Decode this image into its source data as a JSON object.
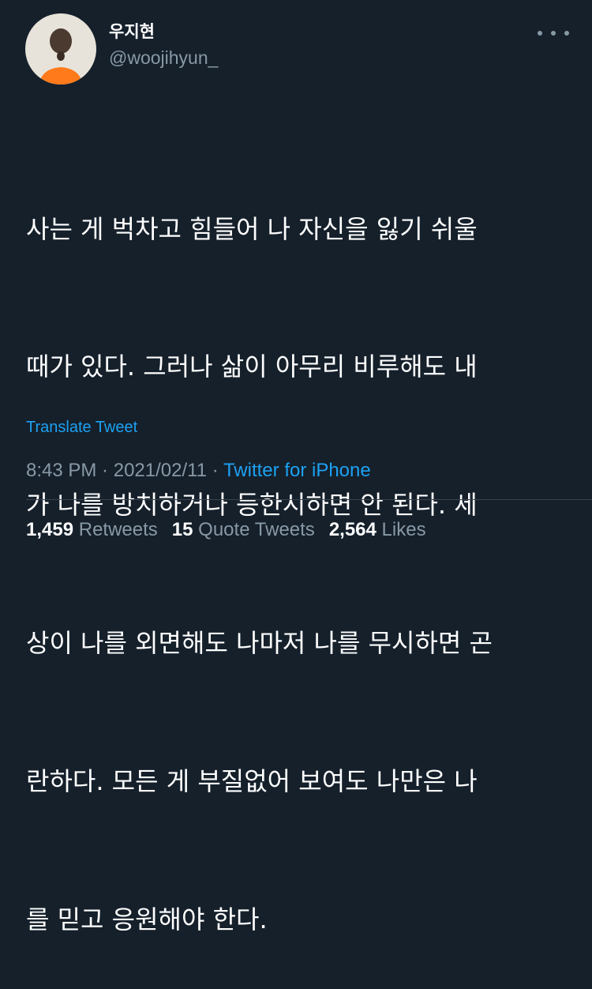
{
  "author": {
    "display_name": "우지현",
    "handle": "@woojihyun_"
  },
  "tweet": {
    "lines": [
      "사는 게 벅차고 힘들어 나 자신을 잃기 쉬울",
      "때가 있다. 그러나 삶이 아무리 비루해도 내",
      "가 나를 방치하거나 등한시하면 안 된다. 세",
      "상이 나를 외면해도 나마저 나를 무시하면 곤",
      "란하다. 모든 게 부질없어 보여도 나만은 나",
      "를 믿고 응원해야 한다."
    ],
    "translate_label": "Translate Tweet"
  },
  "meta": {
    "time": "8:43 PM",
    "separator1": " · ",
    "date": "2021/02/11",
    "separator2": " · ",
    "source": "Twitter for iPhone"
  },
  "stats": {
    "retweets_count": "1,459",
    "retweets_label": "Retweets",
    "quotes_count": "15",
    "quotes_label": "Quote Tweets",
    "likes_count": "2,564",
    "likes_label": "Likes"
  },
  "icons": {
    "more": "more-horizontal-icon"
  },
  "colors": {
    "background": "#15202b",
    "text": "#ffffff",
    "secondary": "#8899a6",
    "accent": "#1da1f2"
  }
}
